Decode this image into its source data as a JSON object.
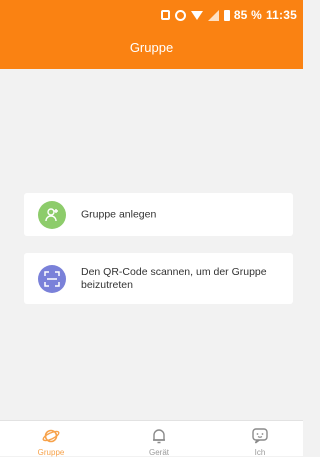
{
  "status_bar": {
    "battery": "85 %",
    "time": "11:35",
    "icons": [
      "vibrate-icon",
      "alarm-icon",
      "wifi-icon",
      "signal-icon",
      "battery-icon"
    ]
  },
  "header": {
    "title": "Gruppe",
    "background_color": "#fa8212"
  },
  "actions": [
    {
      "label": "Gruppe anlegen",
      "icon": "add-user-icon",
      "icon_color": "#8dcc6b"
    },
    {
      "label": "Den QR-Code scannen, um der Gruppe beizutreten",
      "icon": "qr-scan-icon",
      "icon_color": "#7a81d9"
    }
  ],
  "bottom_nav": {
    "items": [
      {
        "label": "Gruppe",
        "icon": "planet-icon",
        "active": true
      },
      {
        "label": "Gerät",
        "icon": "bell-icon",
        "active": false
      },
      {
        "label": "Ich",
        "icon": "chat-face-icon",
        "active": false
      }
    ],
    "active_color": "#f7a24a"
  }
}
